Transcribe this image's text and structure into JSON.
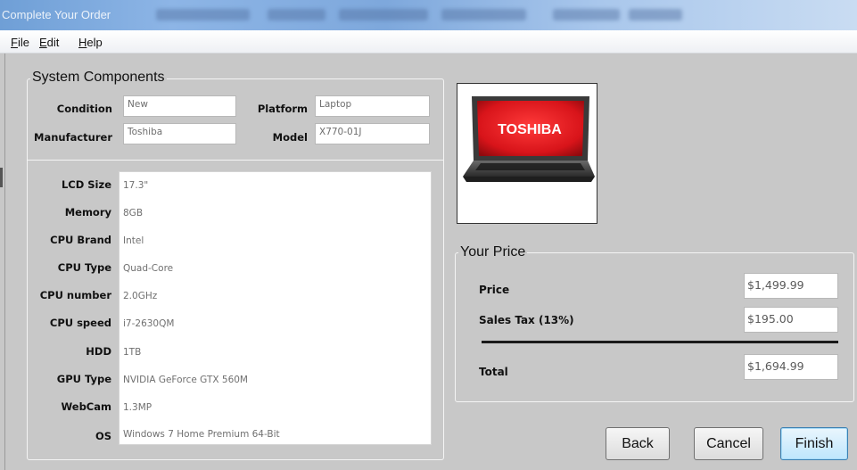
{
  "window": {
    "title": "Complete Your Order"
  },
  "menu": [
    {
      "mnemonic": "F",
      "rest": "ile"
    },
    {
      "mnemonic": "E",
      "rest": "dit"
    },
    {
      "mnemonic": "H",
      "rest": "elp"
    }
  ],
  "system_components": {
    "title": "System Components",
    "condition_label": "Condition",
    "condition_value": "New",
    "platform_label": "Platform",
    "platform_value": "Laptop",
    "manufacturer_label": "Manufacturer",
    "manufacturer_value": "Toshiba",
    "model_label": "Model",
    "model_value": "X770-01J",
    "specs": [
      {
        "label": "LCD Size",
        "value": "17.3\""
      },
      {
        "label": "Memory",
        "value": "8GB"
      },
      {
        "label": "CPU Brand",
        "value": "Intel"
      },
      {
        "label": "CPU Type",
        "value": "Quad-Core"
      },
      {
        "label": "CPU number",
        "value": "2.0GHz"
      },
      {
        "label": "CPU speed",
        "value": "i7-2630QM"
      },
      {
        "label": "HDD",
        "value": "1TB"
      },
      {
        "label": "GPU Type",
        "value": "NVIDIA GeForce GTX 560M"
      },
      {
        "label": "WebCam",
        "value": "1.3MP"
      },
      {
        "label": "OS",
        "value": "Windows 7 Home Premium 64-Bit"
      }
    ]
  },
  "product_image": {
    "brand_text": "TOSHIBA"
  },
  "your_price": {
    "title": "Your Price",
    "price_label": "Price",
    "price_value": "$1,499.99",
    "tax_label": "Sales Tax (13%)",
    "tax_value": "$195.00",
    "total_label": "Total",
    "total_value": "$1,694.99"
  },
  "buttons": {
    "back": "Back",
    "cancel": "Cancel",
    "finish": "Finish"
  },
  "colors": {
    "window_bg": "#c8c8c8",
    "primary_button": "#bee6fd",
    "screen_red": "#d8141a"
  }
}
